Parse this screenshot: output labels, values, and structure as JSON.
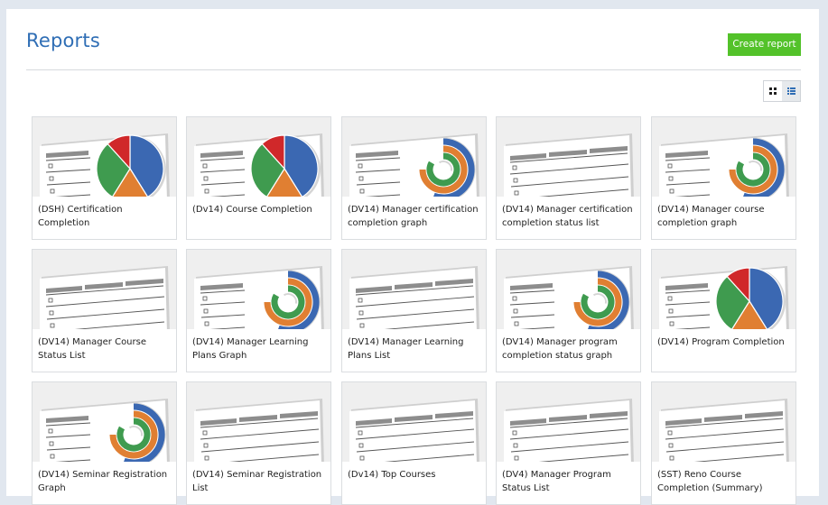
{
  "header": {
    "title": "Reports",
    "create_button": "Create report"
  },
  "view_toggle": {
    "active": "grid",
    "grid_icon": "grid-view-icon",
    "list_icon": "list-view-icon"
  },
  "colors": {
    "title": "#2f6eb5",
    "create_button": "#53c22a",
    "pie_blue": "#3b68b2",
    "pie_orange": "#e07f32",
    "pie_green": "#3f9b4f",
    "pie_red": "#d0282a"
  },
  "reports": [
    {
      "name": "(DSH) Certification Completion",
      "thumbnail": "pie-chart"
    },
    {
      "name": "(Dv14) Course Completion",
      "thumbnail": "pie-chart"
    },
    {
      "name": "(DV14) Manager certification completion graph",
      "thumbnail": "radial-bar"
    },
    {
      "name": "(DV14) Manager certification completion status list",
      "thumbnail": "table-list"
    },
    {
      "name": "(DV14) Manager course completion graph",
      "thumbnail": "radial-bar"
    },
    {
      "name": "(DV14) Manager Course Status List",
      "thumbnail": "table-list"
    },
    {
      "name": "(DV14) Manager Learning Plans Graph",
      "thumbnail": "radial-bar"
    },
    {
      "name": "(DV14) Manager Learning Plans List",
      "thumbnail": "table-list"
    },
    {
      "name": "(DV14) Manager program completion status graph",
      "thumbnail": "radial-bar"
    },
    {
      "name": "(DV14) Program Completion",
      "thumbnail": "pie-chart"
    },
    {
      "name": "(DV14) Seminar Registration Graph",
      "thumbnail": "radial-bar"
    },
    {
      "name": "(DV14) Seminar Registration List",
      "thumbnail": "table-list"
    },
    {
      "name": "(Dv14) Top Courses",
      "thumbnail": "table-list"
    },
    {
      "name": "(DV4) Manager Program Status List",
      "thumbnail": "table-list"
    },
    {
      "name": "(SST) Reno Course Completion (Summary)",
      "thumbnail": "table-list"
    }
  ]
}
